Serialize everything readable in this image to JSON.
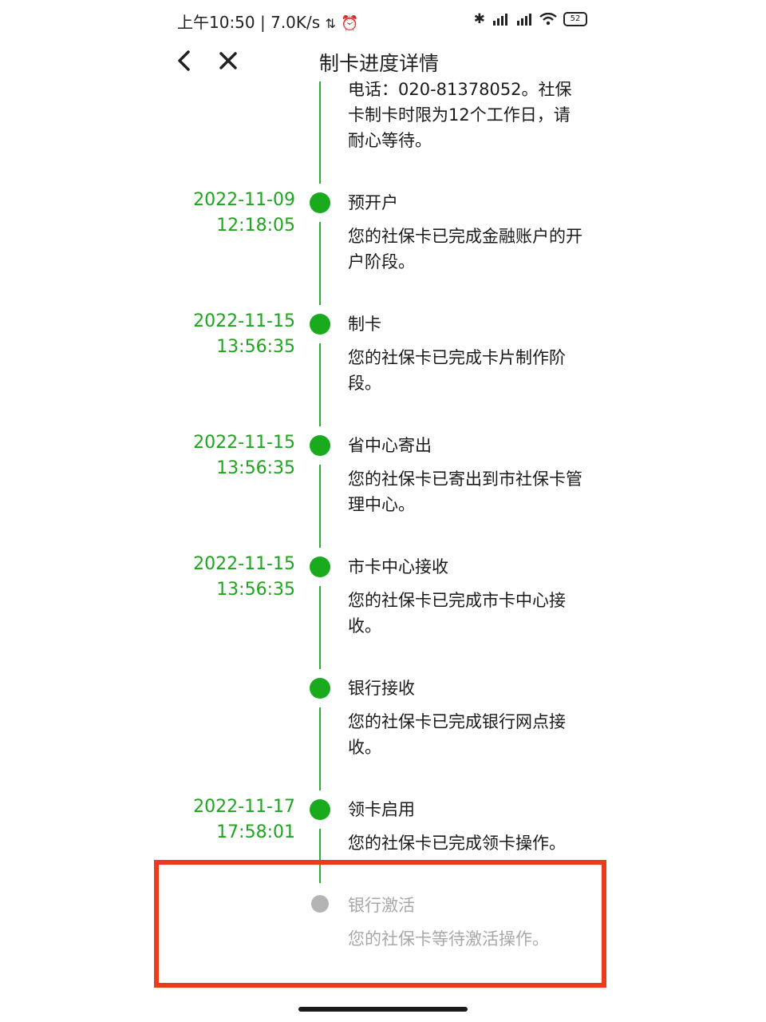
{
  "status_bar": {
    "time_speed": "上午10:50 | 7.0K/s",
    "battery": "52"
  },
  "header": {
    "title": "制卡进度详情"
  },
  "partial_top_text": [
    "电话：020-81378052。社保",
    "卡制卡时限为12个工作日，请",
    "耐心等待。"
  ],
  "timeline": [
    {
      "date": "2022-11-09",
      "time": "12:18:05",
      "title": "预开户",
      "desc": "您的社保卡已完成金融账户的开户阶段。"
    },
    {
      "date": "2022-11-15",
      "time": "13:56:35",
      "title": "制卡",
      "desc": "您的社保卡已完成卡片制作阶段。"
    },
    {
      "date": "2022-11-15",
      "time": "13:56:35",
      "title": "省中心寄出",
      "desc": "您的社保卡已寄出到市社保卡管理中心。"
    },
    {
      "date": "2022-11-15",
      "time": "13:56:35",
      "title": "市卡中心接收",
      "desc": "您的社保卡已完成市卡中心接收。"
    },
    {
      "date": "",
      "time": "",
      "title": "银行接收",
      "desc": "您的社保卡已完成银行网点接收。"
    },
    {
      "date": "2022-11-17",
      "time": "17:58:01",
      "title": "领卡启用",
      "desc": "您的社保卡已完成领卡操作。"
    },
    {
      "date": "",
      "time": "",
      "title": "银行激活",
      "desc": "您的社保卡等待激活操作。"
    }
  ],
  "colors": {
    "accent_green": "#19ab1d",
    "pending_gray": "#b4b4b4",
    "highlight_red": "#ec3b1c"
  }
}
